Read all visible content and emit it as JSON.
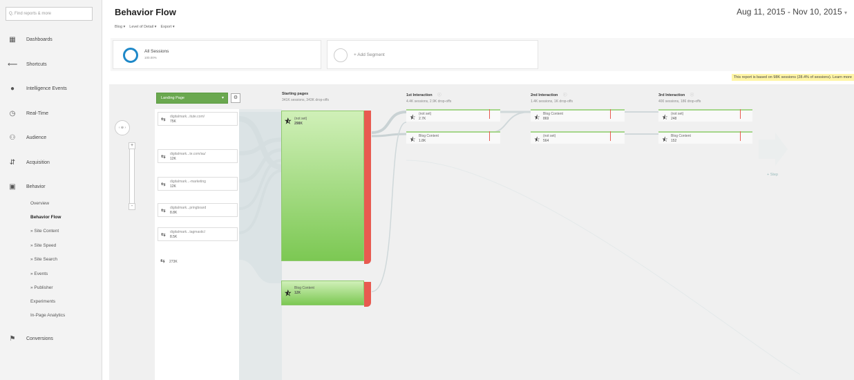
{
  "search": {
    "placeholder": "Q, Find reports & more"
  },
  "nav": {
    "dashboards": "Dashboards",
    "shortcuts": "Shortcuts",
    "intelligence": "Intelligence Events",
    "realtime": "Real-Time",
    "audience": "Audience",
    "acquisition": "Acquisition",
    "behavior": "Behavior",
    "conversions": "Conversions"
  },
  "behavior_sub": [
    "Overview",
    "Behavior Flow",
    "» Site Content",
    "» Site Speed",
    "» Site Search",
    "» Events",
    "» Publisher",
    "Experiments",
    "In-Page Analytics"
  ],
  "header": {
    "title": "Behavior Flow",
    "date_range": "Aug 11, 2015 - Nov 10, 2015",
    "date_caret": "▾",
    "toolbar": [
      "Blog ▾",
      "Level of Detail ▾",
      "Export ▾"
    ]
  },
  "segments": {
    "all_label": "All Sessions",
    "all_sub": "100.00%",
    "add_label": "+ Add Segment"
  },
  "notice": "This report is based on 98K sessions (28.4% of sessions). Learn more",
  "flow": {
    "landing_dropdown": "Landing Page",
    "landing_caret": "▾",
    "gear": "⚙",
    "zoom_in": "+",
    "zoom_out": "-",
    "pan": "‹ ⊕ ›",
    "sources": [
      {
        "name": "digitalmark...itute.com/",
        "value": "75K"
      },
      {
        "name": "digitalmark...te.com/au/",
        "value": "12K"
      },
      {
        "name": "digitalmark...-marketing",
        "value": "12K"
      },
      {
        "name": "digitalmark...pringboard",
        "value": "8.8K"
      },
      {
        "name": "digitalmark...tagmastic/",
        "value": "8.5K"
      },
      {
        "name": "",
        "value": "273K"
      }
    ],
    "starting": {
      "title": "Starting pages",
      "sub": "341K sessions, 343K drop-offs",
      "nodes": [
        {
          "name": "(not set)",
          "value": "298K"
        },
        {
          "name": "Blog Content",
          "value": "12K"
        }
      ]
    },
    "interactions": [
      {
        "title": "1st Interaction",
        "sub": "4.4K sessions, 2.9K drop-offs",
        "nodes": [
          {
            "name": "(not set)",
            "value": "2.7K"
          },
          {
            "name": "Blog Content",
            "value": "1.8K"
          }
        ]
      },
      {
        "title": "2nd Interaction",
        "sub": "1.4K sessions, 1K drop-offs",
        "nodes": [
          {
            "name": "Blog Content",
            "value": "869"
          },
          {
            "name": "(not set)",
            "value": "564"
          }
        ]
      },
      {
        "title": "3rd Interaction",
        "sub": "400 sessions, 186 drop-offs",
        "nodes": [
          {
            "name": "(not set)",
            "value": "248"
          },
          {
            "name": "Blog Content",
            "value": "152"
          }
        ]
      }
    ],
    "step": "+ Step",
    "info_icon": "ⓘ"
  }
}
